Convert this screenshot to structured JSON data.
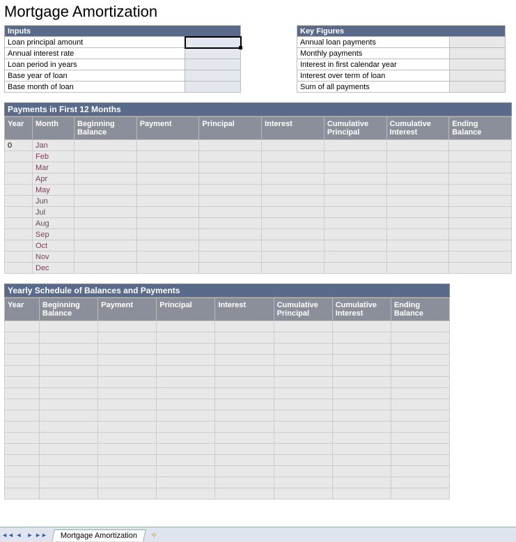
{
  "page_title": "Mortgage Amortization",
  "inputs": {
    "header": "Inputs",
    "rows": [
      {
        "label": "Loan principal amount",
        "value": ""
      },
      {
        "label": "Annual interest rate",
        "value": ""
      },
      {
        "label": "Loan period in years",
        "value": ""
      },
      {
        "label": "Base year of loan",
        "value": ""
      },
      {
        "label": "Base month of loan",
        "value": ""
      }
    ]
  },
  "key_figures": {
    "header": "Key Figures",
    "rows": [
      {
        "label": "Annual loan payments",
        "value": ""
      },
      {
        "label": "Monthly payments",
        "value": ""
      },
      {
        "label": "Interest in first calendar year",
        "value": ""
      },
      {
        "label": "Interest over term of loan",
        "value": ""
      },
      {
        "label": "Sum of all payments",
        "value": ""
      }
    ]
  },
  "first12": {
    "header": "Payments in First 12 Months",
    "columns": [
      "Year",
      "Month",
      "Beginning Balance",
      "Payment",
      "Principal",
      "Interest",
      "Cumulative Principal",
      "Cumulative Interest",
      "Ending Balance"
    ],
    "year0": "0",
    "months": [
      "Jan",
      "Feb",
      "Mar",
      "Apr",
      "May",
      "Jun",
      "Jul",
      "Aug",
      "Sep",
      "Oct",
      "Nov",
      "Dec"
    ]
  },
  "yearly": {
    "header": "Yearly Schedule of Balances and Payments",
    "columns": [
      "Year",
      "Beginning Balance",
      "Payment",
      "Principal",
      "Interest",
      "Cumulative Principal",
      "Cumulative Interest",
      "Ending Balance"
    ],
    "row_count": 16
  },
  "sheet_tab": "Mortgage Amortization"
}
